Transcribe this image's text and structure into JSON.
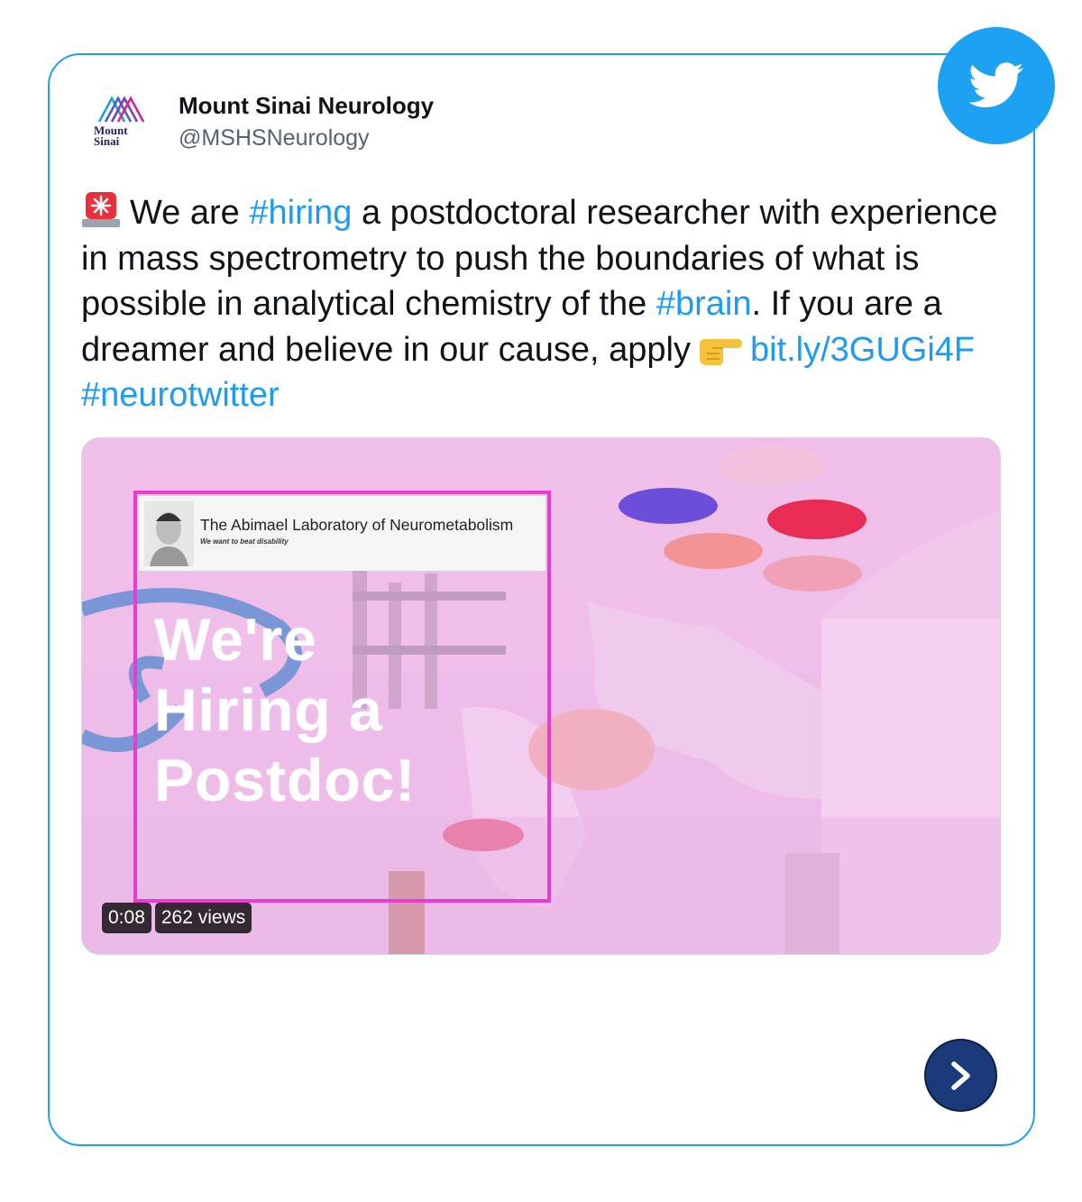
{
  "author": {
    "logo_text": "Mount Sinai",
    "name": "Mount Sinai Neurology",
    "handle": "@MSHSNeurology"
  },
  "tweet": {
    "t1": "We are ",
    "hashtag_hiring": "#hiring",
    "t2": " a postdoctoral researcher with experience in mass spectrometry to push the boundaries of what is possible in analytical chemistry of the ",
    "hashtag_brain": "#brain",
    "t3": ". If you are a dreamer and believe in our cause, apply",
    "link": "bit.ly/3GUGi4F",
    "hashtag_neuro": "#neurotwitter"
  },
  "media": {
    "lab_title": "The Abimael Laboratory of Neurometabolism",
    "lab_subtitle": "We want to beat disability",
    "headline_line1": "We're",
    "headline_line2": "Hiring a",
    "headline_line3": "Postdoc!",
    "duration": "0:08",
    "views": "262 views"
  },
  "icons": {
    "badge": "twitter-bird-icon",
    "alarm": "rotating-light-emoji",
    "point": "pointing-right-emoji",
    "next": "chevron-right-icon"
  },
  "colors": {
    "twitter_blue": "#1da1f2",
    "link_blue": "#1d9bf0",
    "frame_pink": "#e83ccc",
    "next_button": "#1a3a7a"
  }
}
